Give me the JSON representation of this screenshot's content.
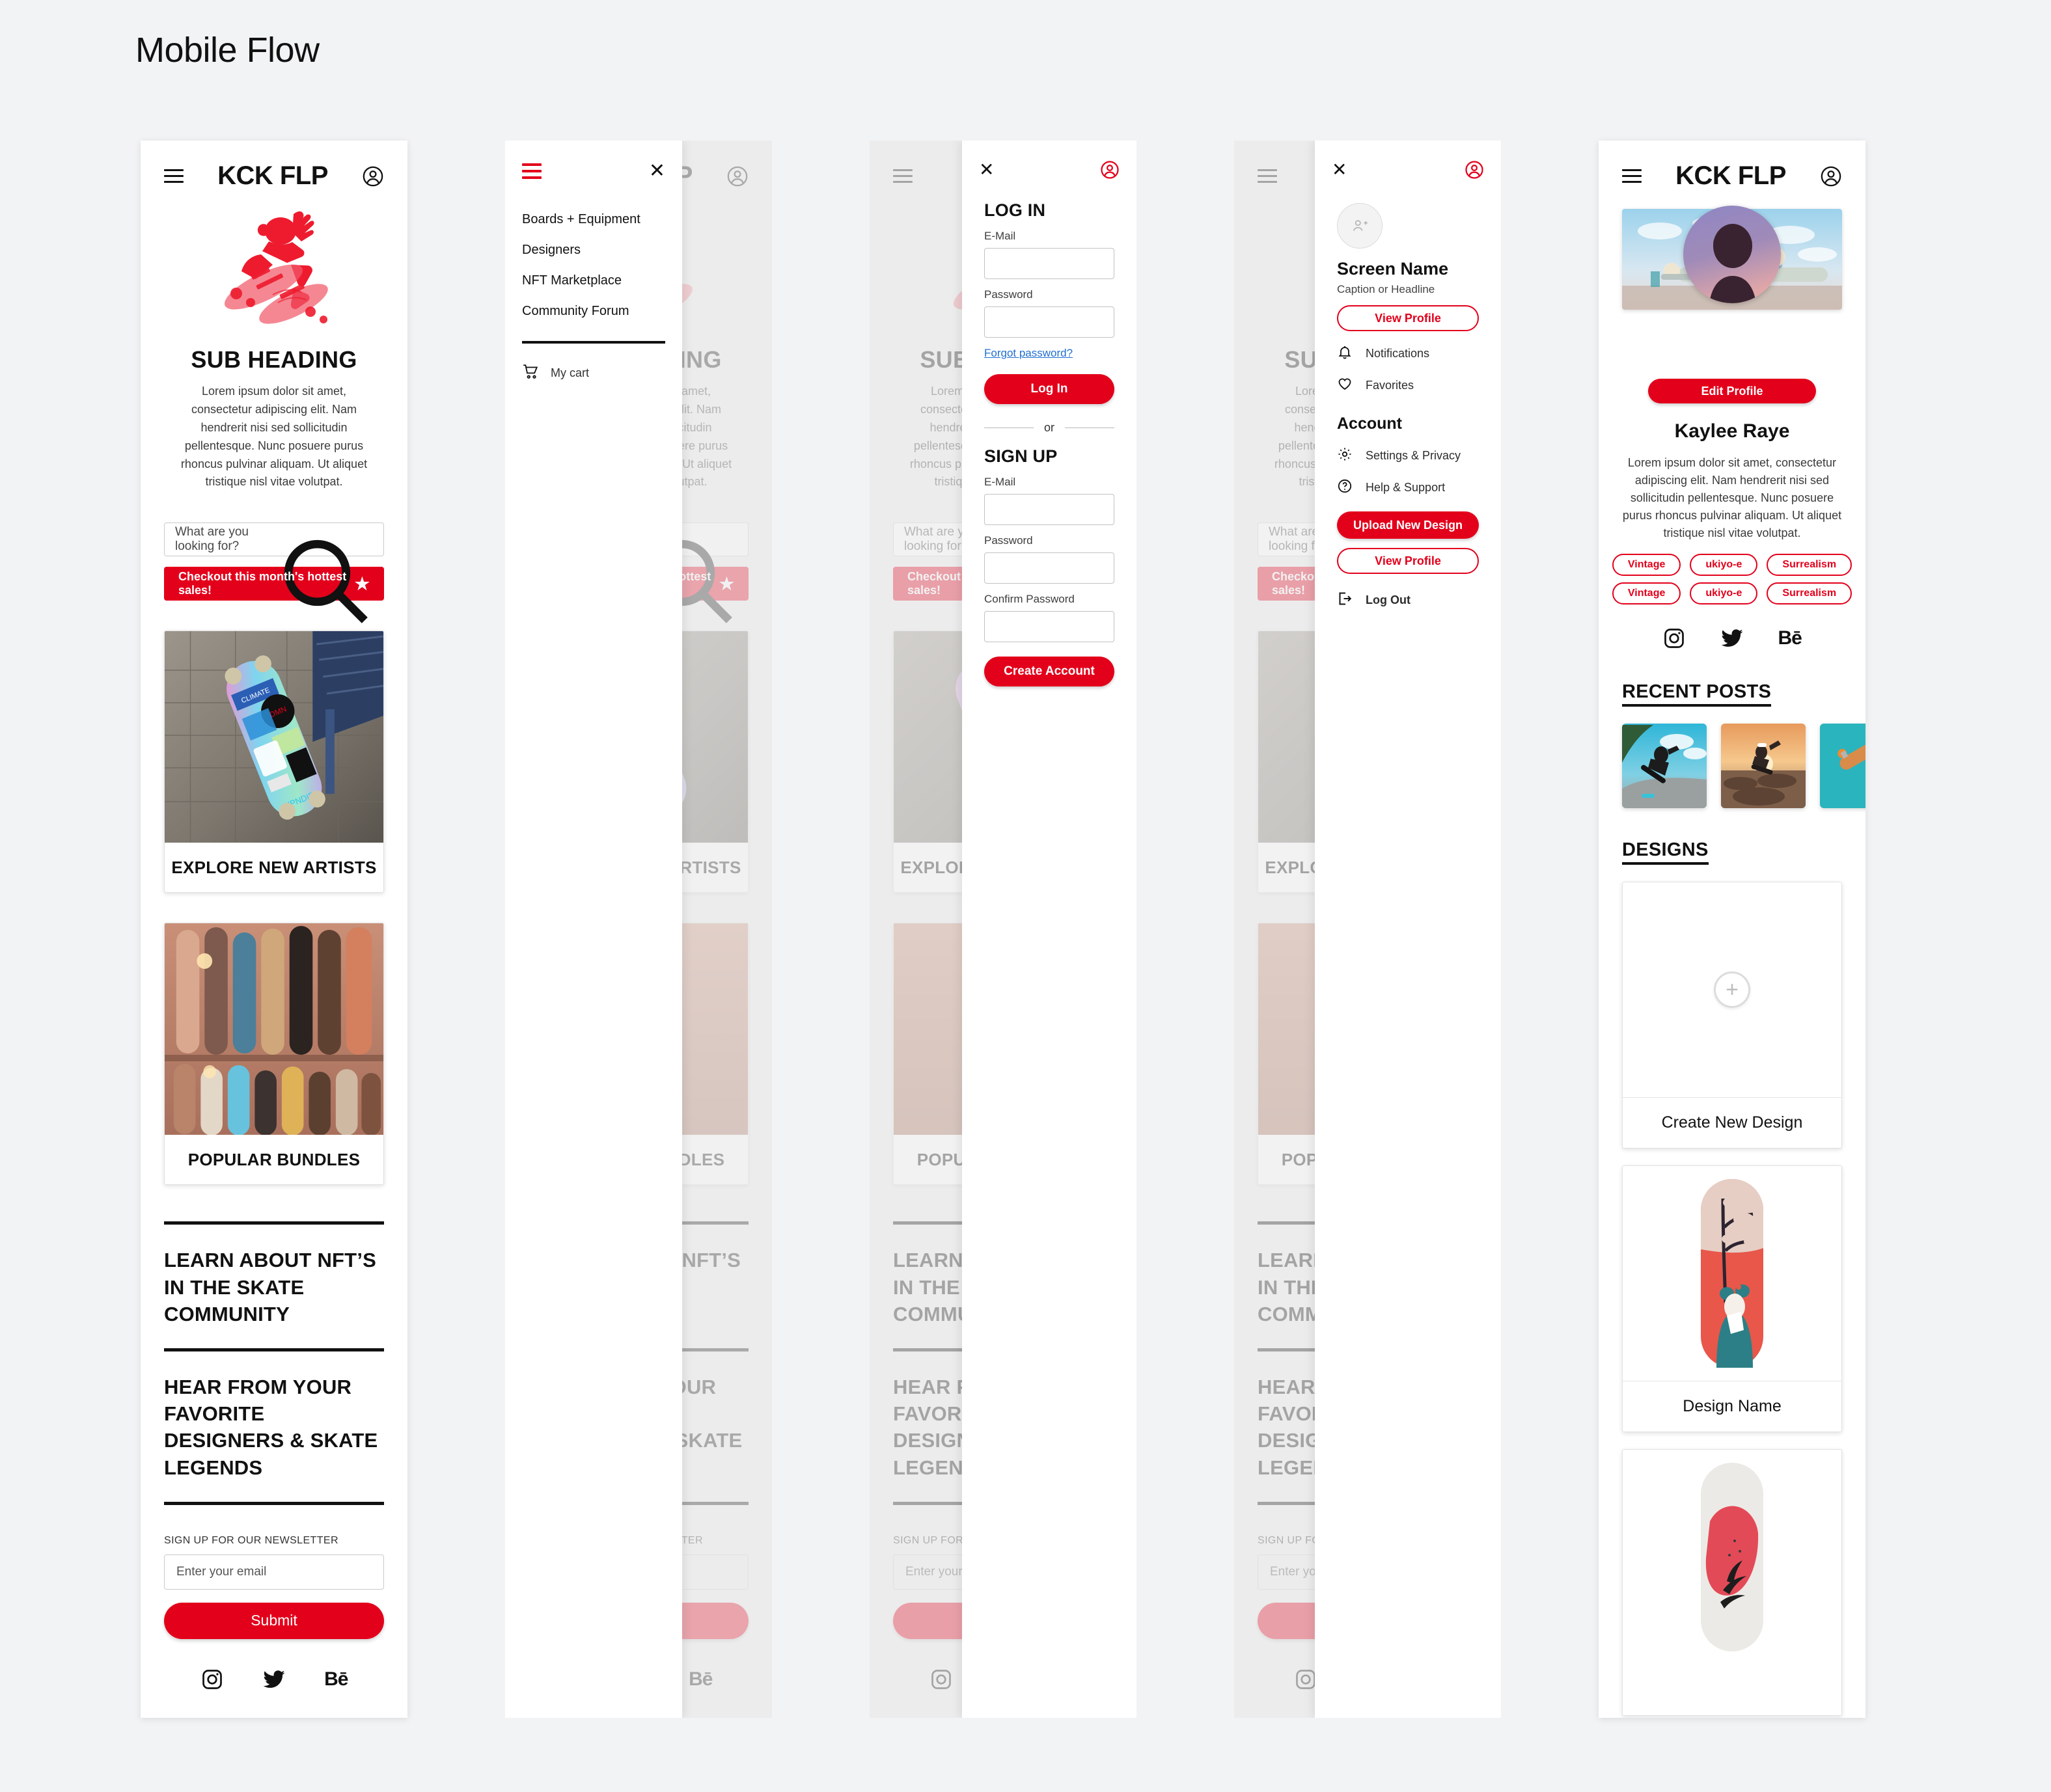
{
  "page": {
    "title": "Mobile Flow",
    "accent": "#e3001b",
    "bg": "#f2f3f5"
  },
  "brand": "KCK FLP",
  "home": {
    "subheading": "SUB HEADING",
    "body": "Lorem ipsum dolor sit amet, consectetur adipiscing elit. Nam hendrerit nisi sed sollicitudin pellentesque. Nunc posuere purus rhoncus pulvinar aliquam. Ut aliquet tristique nisl vitae volutpat.",
    "search_placeholder": "What are you looking for?",
    "sales_cta": "Checkout this month's hottest sales!",
    "card1_caption": "EXPLORE NEW ARTISTS",
    "card2_caption": "POPULAR BUNDLES",
    "promo1": "LEARN ABOUT NFT’S IN THE SKATE COMMUNITY",
    "promo2": "HEAR FROM YOUR FAVORITE DESIGNERS & SKATE LEGENDS",
    "newsletter_label": "SIGN UP FOR OUR NEWSLETTER",
    "newsletter_placeholder": "Enter your email",
    "submit_label": "Submit",
    "socials": [
      "instagram-icon",
      "twitter-icon",
      "behance-icon"
    ]
  },
  "menu": {
    "items": [
      "Boards + Equipment",
      "Designers",
      "NFT Marketplace",
      "Community Forum"
    ],
    "cart_label": "My cart",
    "close_label": "✕"
  },
  "auth": {
    "login_title": "LOG IN",
    "email_label": "E-Mail",
    "password_label": "Password",
    "confirm_label": "Confirm Password",
    "forgot": "Forgot password?",
    "login_button": "Log In",
    "or": "or",
    "signup_title": "SIGN UP",
    "create_button": "Create Account"
  },
  "account": {
    "screen_name": "Screen Name",
    "caption": "Caption or Headline",
    "view_profile": "View Profile",
    "notifications": "Notifications",
    "favorites": "Favorites",
    "section_title": "Account",
    "settings": "Settings & Privacy",
    "help": "Help & Support",
    "upload": "Upload New Design",
    "view_profile_2": "View Profile",
    "logout": "Log Out"
  },
  "profile": {
    "edit_button": "Edit Profile",
    "name": "Kaylee Raye",
    "bio": "Lorem ipsum dolor sit amet, consectetur adipiscing elit. Nam hendrerit nisi sed sollicitudin pellentesque. Nunc posuere purus rhoncus pulvinar aliquam. Ut aliquet tristique nisl vitae volutpat.",
    "tags_row1": [
      "Vintage",
      "ukiyo-e",
      "Surrealism"
    ],
    "tags_row2": [
      "Vintage",
      "ukiyo-e",
      "Surrealism"
    ],
    "recent_posts_title": "RECENT POSTS",
    "designs_title": "DESIGNS",
    "create_new_design": "Create New Design",
    "design_name": "Design Name"
  }
}
